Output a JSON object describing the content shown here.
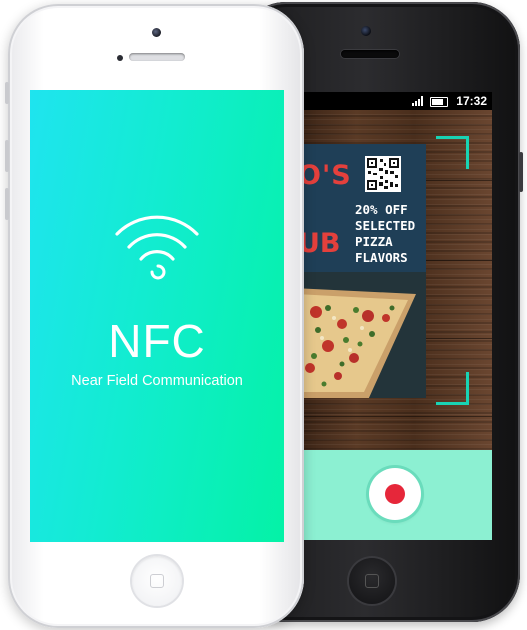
{
  "nfc_phone": {
    "title": "NFC",
    "subtitle": "Near Field Communication",
    "gradient_colors": [
      "#1fe4ef",
      "#04f2a6"
    ],
    "icon": "nfc-signal-icon"
  },
  "scanner_phone": {
    "status_bar": {
      "time": "17:32",
      "icons": [
        "signal-icon",
        "battery-icon"
      ]
    },
    "poster": {
      "title_line_1": "O'S",
      "title_line_2": "UB",
      "promo_lines": [
        "20% OFF",
        "SELECTED",
        "PIZZA",
        "FLAVORS"
      ],
      "qr_icon": "qr-code-icon"
    },
    "capture": {
      "button_icon": "record-icon",
      "accent_color": "#8cf0d2",
      "record_color": "#e6273a"
    },
    "frame_color": "#19d3b4"
  }
}
